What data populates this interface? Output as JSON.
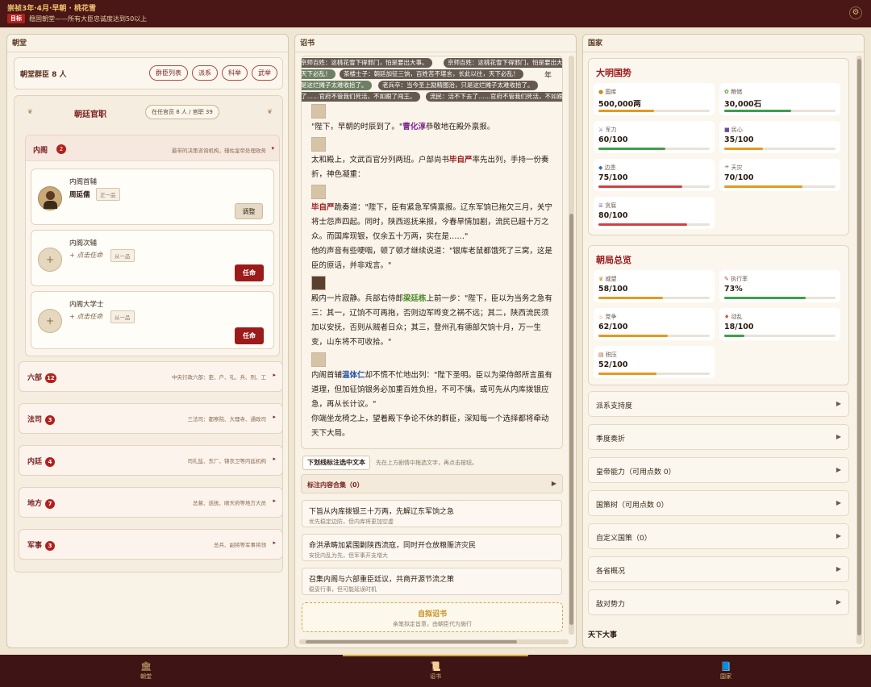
{
  "header": {
    "title": "崇祯3年·4月·早朝 · 桃花雪",
    "goal_badge": "目标",
    "goal_text": "稳固朝堂——所有大臣忠诚度达到50以上"
  },
  "left": {
    "panel_title": "朝堂",
    "ministers_label": "朝堂群臣 8 人",
    "buttons": [
      "群臣列表",
      "派系",
      "科举",
      "武举"
    ],
    "officials_title": "朝廷官职",
    "officials_count": "在任官员 8 人 / 官职 39",
    "neige": {
      "name": "内阁",
      "count": "2",
      "desc": "最带的决策咨询机构，辅佐皇帝处理政务",
      "posts": [
        {
          "title": "内阁首辅",
          "holder": "周延儒",
          "rank": "正一品",
          "action": "调整"
        },
        {
          "title": "内阁次辅",
          "holder": "+ 点击任命",
          "rank": "从一品",
          "action": "任命"
        },
        {
          "title": "内阁大学士",
          "holder": "+ 点击任命",
          "rank": "从一品",
          "action": "任命"
        }
      ]
    },
    "departments": [
      {
        "name": "六部",
        "count": "12",
        "desc": "中央行政六部：吏、户、礼、兵、刑、工"
      },
      {
        "name": "法司",
        "count": "3",
        "desc": "三法司：都察院、大理寺、通政司"
      },
      {
        "name": "内廷",
        "count": "4",
        "desc": "司礼监、东厂、锦衣卫等内廷机构"
      },
      {
        "name": "地方",
        "count": "7",
        "desc": "总督、巡抚、顺天府等地方大员"
      },
      {
        "name": "军事",
        "count": "3",
        "desc": "总兵、副将等军事将领"
      }
    ]
  },
  "middle": {
    "panel_title": "诏书",
    "tickers": [
      "京师百姓：这桃花雪下得邪门，怕是要出大事。",
      "京师百姓：这桃花雪下得邪门，怕是要出大",
      "天下必乱！",
      "茶楼士子：朝廷加征三饷，百姓苦不堪言，长此以往，天下必乱！",
      "年",
      "是这烂摊子太难收拾了。",
      "老兵卒：当今圣上励精图治，只是这烂摊子太难收拾了。",
      "了……官府不管我们死活，不如跟了闯王。",
      "流民：活不下去了……官府不管我们死活，不如跟"
    ],
    "story": {
      "p1_pre": "\"陛下，早朝的时辰到了。\"",
      "p1_name": "曹化淳",
      "p1_post": "恭敬地在殿外禀报。",
      "p2_pre": "太和殿上，文武百官分列两班。户部尚书",
      "p2_name": "毕自严",
      "p2_post": "率先出列，手持一份奏折，神色凝重：",
      "p3_name": "毕自严",
      "p3_text": "跪奏道：\"陛下，臣有紧急军情禀报。辽东军饷已拖欠三月，关宁将士怨声四起。同时，陕西巡抚来报，今春旱情加剧，流民已超十万之众。而国库现银，仅余五十万两，实在是……\"",
      "p4": "他的声音有些哽咽，顿了顿才继续说道：\"银库老鼠都饿死了三窝，这是臣的原话，并非戏言。\"",
      "p5_pre": "殿内一片寂静。兵部右侍郎",
      "p5_name": "梁廷栋",
      "p5_post": "上前一步：\"陛下，臣以为当务之急有三：其一，辽饷不可再拖，否则边军哗变之祸不远；其二，陕西流民须加以安抚，否则从贼者日众；其三，登州孔有德部欠饷十月，万一生变，山东将不可收拾。\"",
      "p6_pre": "内阁首辅",
      "p6_name": "温体仁",
      "p6_post": "却不慌不忙地出列：\"陛下圣明。臣以为梁侍郎所言虽有道理，但加征饷银务必加重百姓负担，不可不慎。或可先从内库拨银应急，再从长计议。\"",
      "p7": "你端坐龙椅之上，望着殿下争论不休的群臣，深知每一个选择都将牵动天下大局。"
    },
    "annotate_button": "下划线标注选中文本",
    "annotate_hint": "先在上方剧情中拖选文字，再点击按钮。",
    "annot_collection": "标注内容合集（0）",
    "choices": [
      {
        "main": "下旨从内库拨银三十万两，先解辽东军饷之急",
        "sub": "优先稳定边防，但内库将更加空虚"
      },
      {
        "main": "命洪承畴加紧围剿陕西流寇，同时开仓放粮赈济灾民",
        "sub": "安抚内乱为先，但军事开支增大"
      },
      {
        "main": "召集内阁与六部重臣廷议，共商开源节流之策",
        "sub": "稳妥行事，但可能延误时机"
      }
    ],
    "custom_edict_title": "自拟诏书",
    "custom_edict_sub": "亲笔拟定旨意，由朝臣代为施行"
  },
  "right": {
    "panel_title": "国家",
    "ming_title": "大明国势",
    "ming_stats": [
      {
        "label": "国库",
        "value": "500,000两",
        "fill": 0.5,
        "color": "#e49a1e"
      },
      {
        "label": "粮储",
        "value": "30,000石",
        "fill": 0.6,
        "color": "#3f9e4a"
      },
      {
        "label": "军力",
        "value": "60/100",
        "fill": 0.6,
        "color": "#3f9e4a"
      },
      {
        "label": "民心",
        "value": "35/100",
        "fill": 0.35,
        "color": "#e49a1e"
      },
      {
        "label": "边患",
        "value": "75/100",
        "fill": 0.75,
        "color": "#d64040"
      },
      {
        "label": "天灾",
        "value": "70/100",
        "fill": 0.7,
        "color": "#e49a1e"
      },
      {
        "label": "贪腐",
        "value": "80/100",
        "fill": 0.8,
        "color": "#d64040"
      }
    ],
    "court_title": "朝局总览",
    "court_stats": [
      {
        "label": "威望",
        "value": "58/100",
        "fill": 0.58,
        "color": "#e49a1e"
      },
      {
        "label": "执行率",
        "value": "73%",
        "fill": 0.73,
        "color": "#3f9e4a"
      },
      {
        "label": "党争",
        "value": "62/100",
        "fill": 0.62,
        "color": "#e49a1e"
      },
      {
        "label": "动乱",
        "value": "18/100",
        "fill": 0.18,
        "color": "#3f9e4a"
      },
      {
        "label": "税压",
        "value": "52/100",
        "fill": 0.52,
        "color": "#e49a1e"
      }
    ],
    "accordions": [
      "派系支持度",
      "季度奏折",
      "皇帝能力（可用点数 0）",
      "国策树（可用点数 0）",
      "自定义国策（0）",
      "各省概况",
      "敌对势力"
    ],
    "tianxia_title": "天下大事"
  },
  "bottom_nav": [
    {
      "label": "朝堂",
      "icon": "temple-icon"
    },
    {
      "label": "诏书",
      "icon": "scroll-icon"
    },
    {
      "label": "国家",
      "icon": "book-icon"
    }
  ]
}
